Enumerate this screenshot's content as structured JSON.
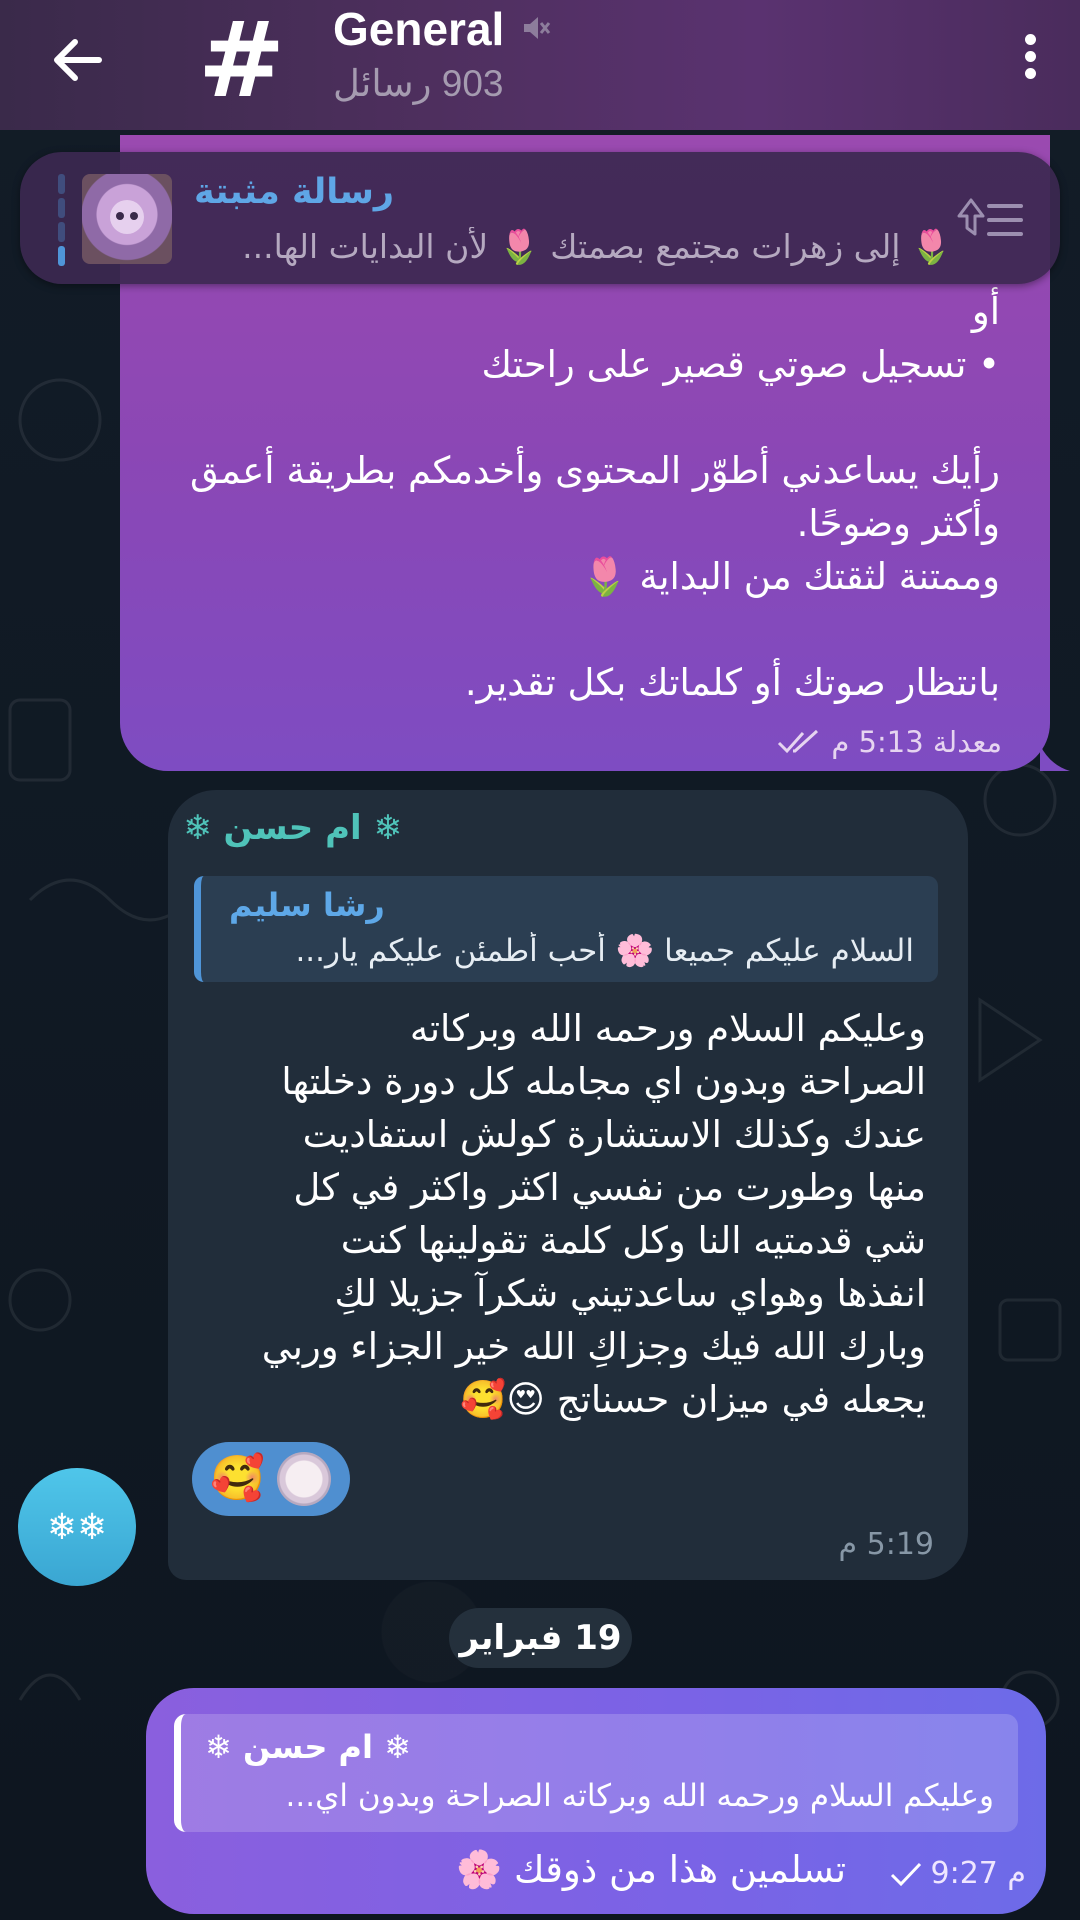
{
  "header": {
    "title": "General",
    "subtitle": "903 رسائل",
    "channel_icon": "#"
  },
  "pinned": {
    "label": "رسالة مثبتة",
    "text": "🌷 إلى زهرات مجتمع بصمتك 🌷 لأن البدايات الها..."
  },
  "message1": {
    "lines": [
      "أو",
      "• تسجيل صوتي قصير على راحتك",
      "",
      "رأيك يساعدني أطوّر المحتوى وأخدمكم بطريقة أعمق",
      "وأكثر وضوحًا.",
      "وممتنة لثقتك من البداية 🌷",
      "",
      "بانتظار صوتك أو كلماتك بكل تقدير."
    ],
    "meta": "معدلة 5:13 م"
  },
  "message2": {
    "sender": "❄ ام حسن ❄",
    "reply_name": "رشا سليم",
    "reply_text": "السلام عليكم جميعا 🌸  أحب أطمئن عليكم يار...",
    "body": "وعليكم السلام ورحمه الله وبركاته\nالصراحة وبدون اي مجامله كل دورة دخلتها\nعندك وكذلك الاستشارة كولش استفاديت\nمنها وطورت من نفسي اكثر واكثر في كل\nشي قدمتيه النا وكل كلمة تقولينها كنت\nانفذها وهواي ساعدتيني شكرآ جزيلا لكِ\nوبارك الله فيك وجزاكِ الله خير الجزاء وربي\nيجعله في ميزان حسناتج 😍🥰",
    "reaction": "🥰",
    "time": "5:19 م"
  },
  "avatar": {
    "text": "❄❄"
  },
  "date_chip": "19 فبراير",
  "message3": {
    "quote_name": "❄ ام حسن ❄",
    "quote_text": "وعليكم السلام ورحمه الله وبركاته  الصراحة وبدون اي...",
    "text": "تسلمين هذا من ذوقك 🌸",
    "time": "9:27 م"
  }
}
